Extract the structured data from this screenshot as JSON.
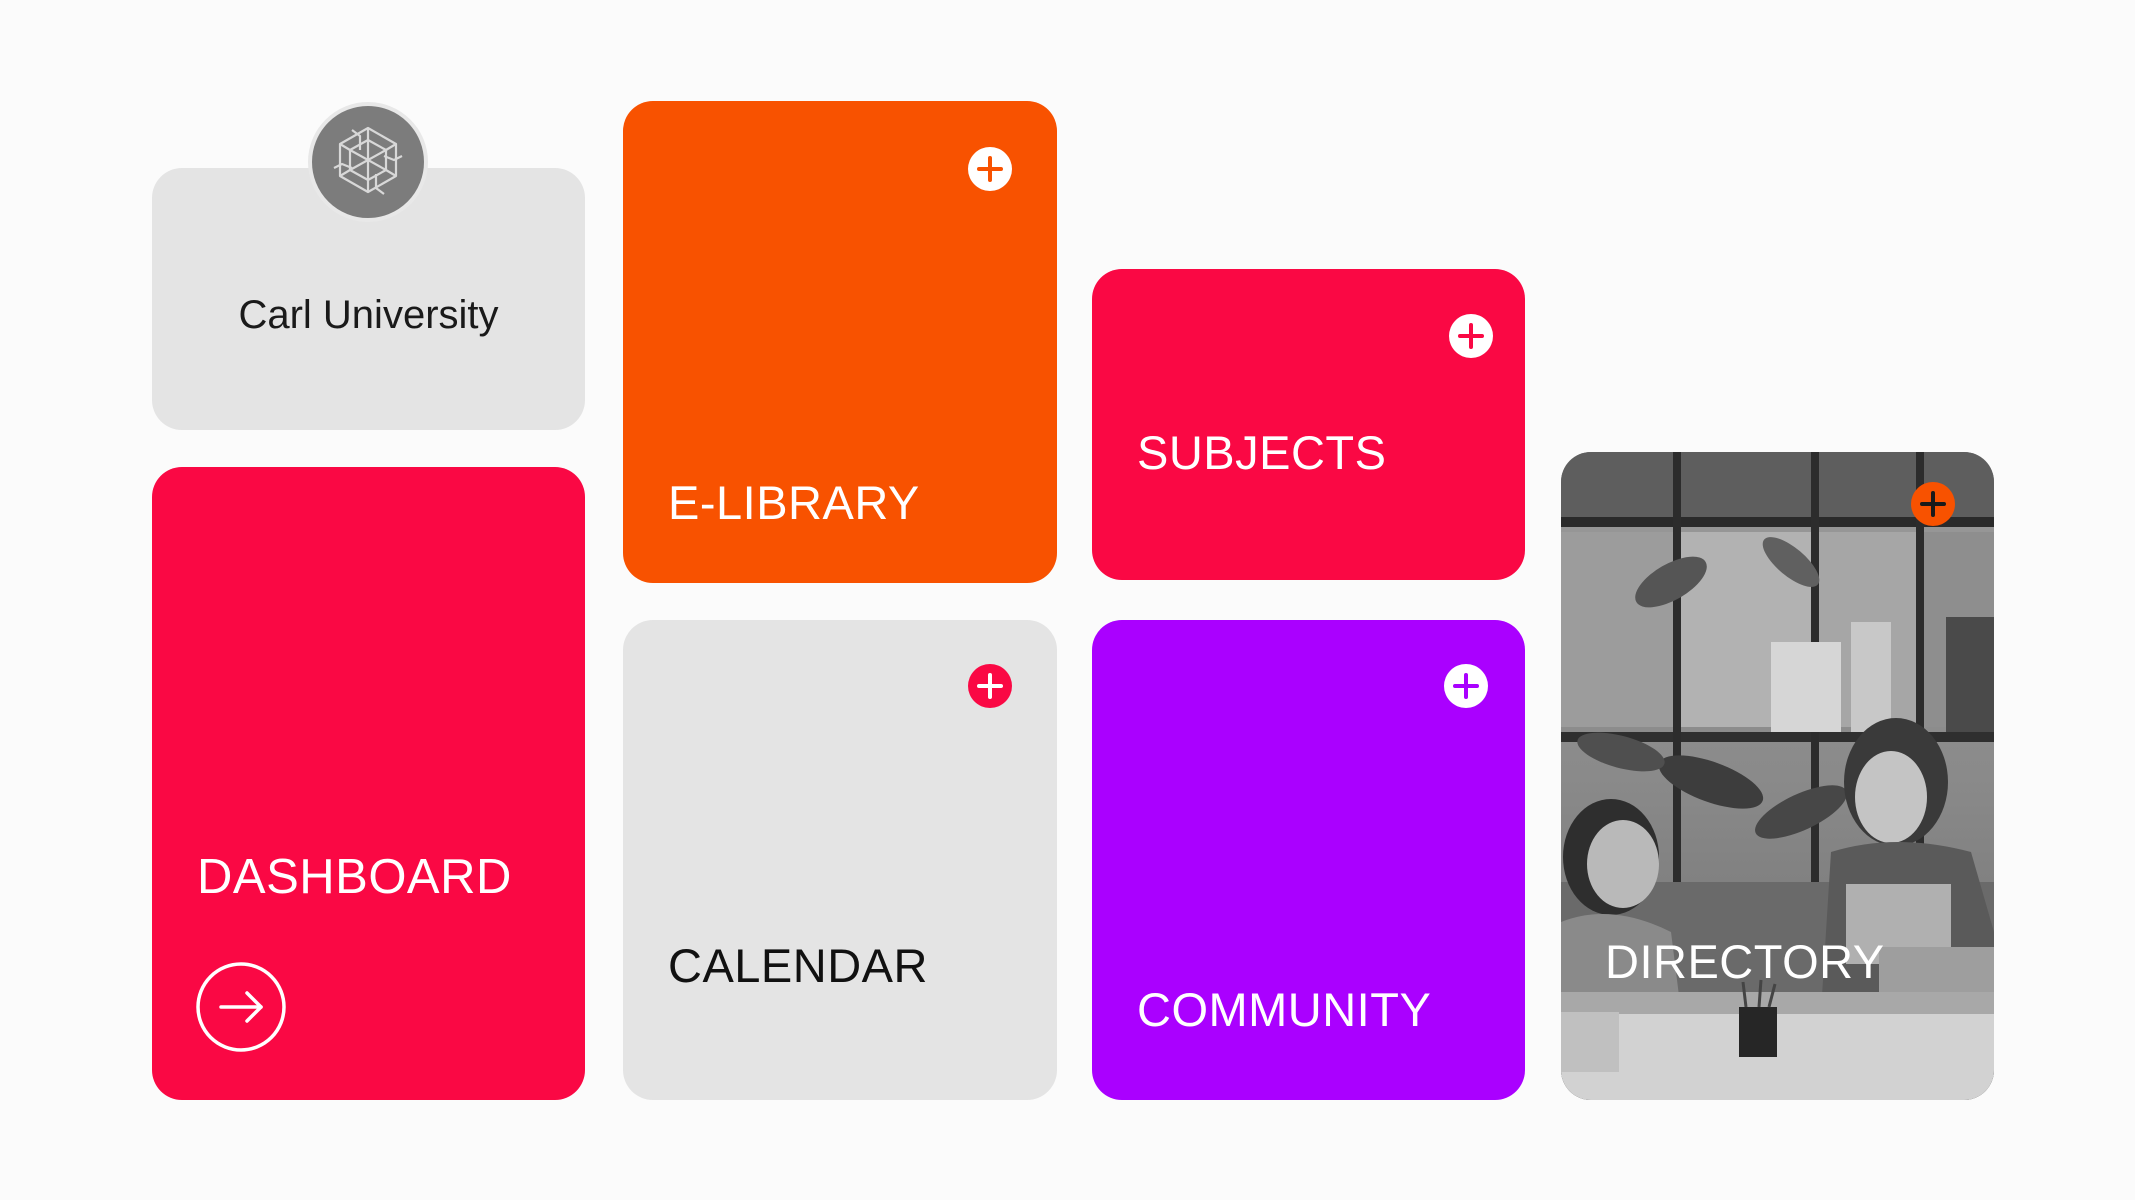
{
  "university": {
    "name": "Carl University",
    "logo_icon": "geometric-knot-logo"
  },
  "tiles": {
    "dashboard": {
      "label": "DASHBOARD",
      "color": "#fa0844",
      "icon": "arrow-right-circle-icon"
    },
    "elibrary": {
      "label": "E-LIBRARY",
      "color": "#f85200",
      "icon": "plus-circle-icon"
    },
    "calendar": {
      "label": "CALENDAR",
      "color": "#e4e4e4",
      "icon": "plus-circle-icon"
    },
    "subjects": {
      "label": "SUBJECTS",
      "color": "#fa0844",
      "icon": "plus-circle-icon"
    },
    "community": {
      "label": "COMMUNITY",
      "color": "#aa00ff",
      "icon": "plus-circle-icon"
    },
    "directory": {
      "label": "DIRECTORY",
      "image": "grayscale photo of two smiling people with headsets at laptops",
      "icon": "plus-circle-icon",
      "icon_color": "#f85200"
    }
  }
}
